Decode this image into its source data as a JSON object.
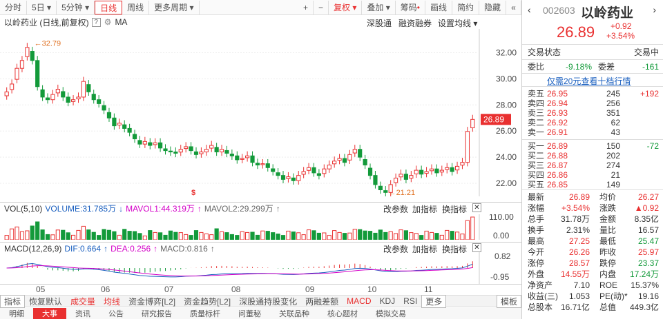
{
  "toolbar": {
    "items": [
      "分时",
      "5日",
      "5分钟",
      "日线",
      "周线",
      "更多周期"
    ],
    "plus": "+",
    "minus": "−",
    "fuquan": "复权",
    "diejia": "叠加",
    "chouma": "筹码",
    "huaxian": "画线",
    "jianyue": "简约",
    "yincang": "隐藏"
  },
  "header": {
    "title": "以岭药业 (日线,前复权)",
    "q": "?",
    "ma": "MA",
    "links": [
      "深股通",
      "融资融券",
      "设置均线"
    ]
  },
  "yaxis": [
    "32.00",
    "30.00",
    "28.00",
    "26.00",
    "24.00",
    "22.00"
  ],
  "annot": {
    "high": "32.79",
    "low": "21.21",
    "s": "$"
  },
  "vol": {
    "name": "VOL(5,10)",
    "volume": "VOLUME:31.785万",
    "mavol1": "MAVOL1:44.319万",
    "mavol2": "MAVOL2:29.299万",
    "ticks": [
      "110.00",
      "0.00"
    ],
    "links": [
      "改参数",
      "加指标",
      "换指标"
    ]
  },
  "macd": {
    "name": "MACD(12,26,9)",
    "dif": "DIF:0.664",
    "dea": "DEA:0.256",
    "macd": "MACD:0.816",
    "ticks": [
      "0.82",
      "-0.95"
    ],
    "links": [
      "改参数",
      "加指标",
      "换指标"
    ]
  },
  "xaxis": [
    "05",
    "06",
    "07",
    "08",
    "09",
    "10",
    "11"
  ],
  "tabs": [
    "指标",
    "恢复默认",
    "成交量",
    "均线",
    "资金博弈[L2]",
    "资金趋势[L2]",
    "深股通持股变化",
    "两融差额",
    "MACD",
    "KDJ",
    "RSI",
    "更多",
    "模板"
  ],
  "bottom": [
    "明细",
    "大事",
    "资讯",
    "公告",
    "研究报告",
    "质量标杆",
    "问董秘",
    "关联品种",
    "核心题材",
    "模拟交易"
  ],
  "quote": {
    "code": "002603",
    "name": "以岭药业",
    "price": "26.89",
    "chg": "+0.92",
    "pct": "+3.54%",
    "status_label": "交易状态",
    "status": "交易中",
    "weibi_label": "委比",
    "weibi": "-9.18%",
    "weicha_label": "委差",
    "weicha": "-161",
    "promo": "仅需20元查看十档行情",
    "asks": [
      {
        "l": "卖五",
        "p": "26.95",
        "v": "245",
        "d": "+192"
      },
      {
        "l": "卖四",
        "p": "26.94",
        "v": "256",
        "d": ""
      },
      {
        "l": "卖三",
        "p": "26.93",
        "v": "351",
        "d": ""
      },
      {
        "l": "卖二",
        "p": "26.92",
        "v": "62",
        "d": ""
      },
      {
        "l": "卖一",
        "p": "26.91",
        "v": "43",
        "d": ""
      }
    ],
    "bids": [
      {
        "l": "买一",
        "p": "26.89",
        "v": "150",
        "d": "-72"
      },
      {
        "l": "买二",
        "p": "26.88",
        "v": "202",
        "d": ""
      },
      {
        "l": "买三",
        "p": "26.87",
        "v": "274",
        "d": ""
      },
      {
        "l": "买四",
        "p": "26.86",
        "v": "21",
        "d": ""
      },
      {
        "l": "买五",
        "p": "26.85",
        "v": "149",
        "d": ""
      }
    ],
    "stats": [
      [
        "最新",
        "26.89",
        "均价",
        "26.27"
      ],
      [
        "涨幅",
        "+3.54%",
        "涨跌",
        "▲0.92"
      ],
      [
        "总手",
        "31.78万",
        "金额",
        "8.35亿"
      ],
      [
        "换手",
        "2.31%",
        "量比",
        "16.57"
      ],
      [
        "最高",
        "27.25",
        "最低",
        "25.47"
      ],
      [
        "今开",
        "26.26",
        "昨收",
        "25.97"
      ],
      [
        "涨停",
        "28.57",
        "跌停",
        "23.37"
      ],
      [
        "外盘",
        "14.55万",
        "内盘",
        "17.24万"
      ],
      [
        "净资产",
        "7.10",
        "ROE",
        "15.37%"
      ],
      [
        "收益(三)",
        "1.053",
        "PE(动)*",
        "19.16"
      ],
      [
        "总股本",
        "16.71亿",
        "总值",
        "449.3亿"
      ]
    ]
  },
  "chart_data": {
    "type": "candlestick",
    "ylim": [
      21,
      33.5
    ],
    "high": 32.79,
    "low": 21.21,
    "last": 26.89,
    "close": [
      29.0,
      29.6,
      30.8,
      31.4,
      32.4,
      31.4,
      29.4,
      28.6,
      28.4,
      28.8,
      29.2,
      28.6,
      28.2,
      28.4,
      28.6,
      29.8,
      29.0,
      28.4,
      28.1,
      27.6,
      27.0,
      26.4,
      26.6,
      26.2,
      25.9,
      25.4,
      25.0,
      25.2,
      24.9,
      25.1,
      24.7,
      24.5,
      24.4,
      24.3,
      24.6,
      24.8,
      24.5,
      24.2,
      24.4,
      24.6,
      24.9,
      24.4,
      24.6,
      24.3,
      24.1,
      23.8,
      23.9,
      24.1,
      23.6,
      23.4,
      23.5,
      23.2,
      22.9,
      22.6,
      22.3,
      22.5,
      22.2,
      22.6,
      22.9,
      23.2,
      22.8,
      22.6,
      23.1,
      23.4,
      23.7,
      23.9,
      23.6,
      24.2,
      24.6,
      24.0,
      23.4,
      22.6,
      21.9,
      21.5,
      21.3,
      21.9,
      22.4,
      22.7,
      22.3,
      22.6,
      23.0,
      22.7,
      22.9,
      23.1,
      22.8,
      23.0,
      23.2,
      22.9,
      23.3,
      23.6,
      25.97,
      26.89
    ]
  }
}
